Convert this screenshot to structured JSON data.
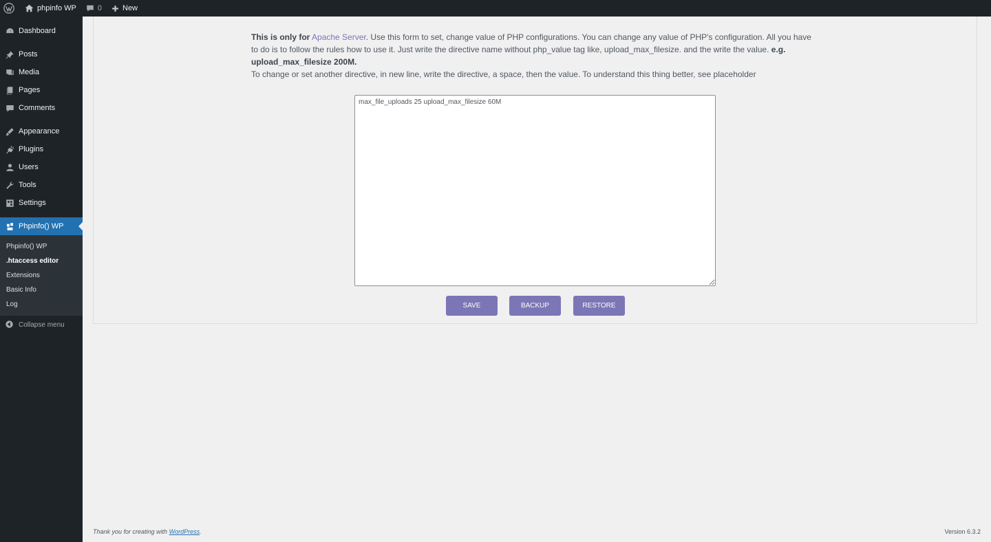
{
  "adminbar": {
    "site_name": "phpinfo WP",
    "comments_count": "0",
    "new_label": "New"
  },
  "sidebar": {
    "items": [
      {
        "label": "Dashboard",
        "icon": "dashboard-icon"
      },
      {
        "label": "Posts",
        "icon": "pin-icon"
      },
      {
        "label": "Media",
        "icon": "media-icon"
      },
      {
        "label": "Pages",
        "icon": "pages-icon"
      },
      {
        "label": "Comments",
        "icon": "comment-icon"
      },
      {
        "label": "Appearance",
        "icon": "brush-icon"
      },
      {
        "label": "Plugins",
        "icon": "plugin-icon"
      },
      {
        "label": "Users",
        "icon": "user-icon"
      },
      {
        "label": "Tools",
        "icon": "wrench-icon"
      },
      {
        "label": "Settings",
        "icon": "settings-icon"
      },
      {
        "label": "Phpinfo() WP",
        "icon": "phpinfo-icon"
      }
    ],
    "submenu": [
      {
        "label": "Phpinfo() WP"
      },
      {
        "label": ".htaccess editor"
      },
      {
        "label": "Extensions"
      },
      {
        "label": "Basic Info"
      },
      {
        "label": "Log"
      }
    ],
    "collapse_label": "Collapse menu"
  },
  "main": {
    "desc_bold": "This is only for",
    "desc_link": "Apache Server",
    "desc_text1": ". Use this form to set, change value of PHP configurations. You can change any value of PHP's configuration. All you have to do is to follow the rules how to use it. Just write the directive name without php_value tag like, upload_max_filesize. and the write the value.",
    "desc_example": "e.g. upload_max_filesize 200M.",
    "desc_line2": "To change or set another directive, in new line, write the directive, a space, then the value. To understand this thing better, see placeholder",
    "editor_value": "max_file_uploads 25 upload_max_filesize 60M",
    "buttons": {
      "save": "SAVE",
      "backup": "BACKUP",
      "restore": "RESTORE"
    }
  },
  "footer": {
    "thanks_prefix": "Thank you for creating with",
    "thanks_link": "WordPress",
    "thanks_suffix": ".",
    "version": "Version 6.3.2"
  },
  "colors": {
    "accent": "#7b76b5",
    "admin_dark": "#1d2327",
    "menu_current": "#2271b1"
  }
}
